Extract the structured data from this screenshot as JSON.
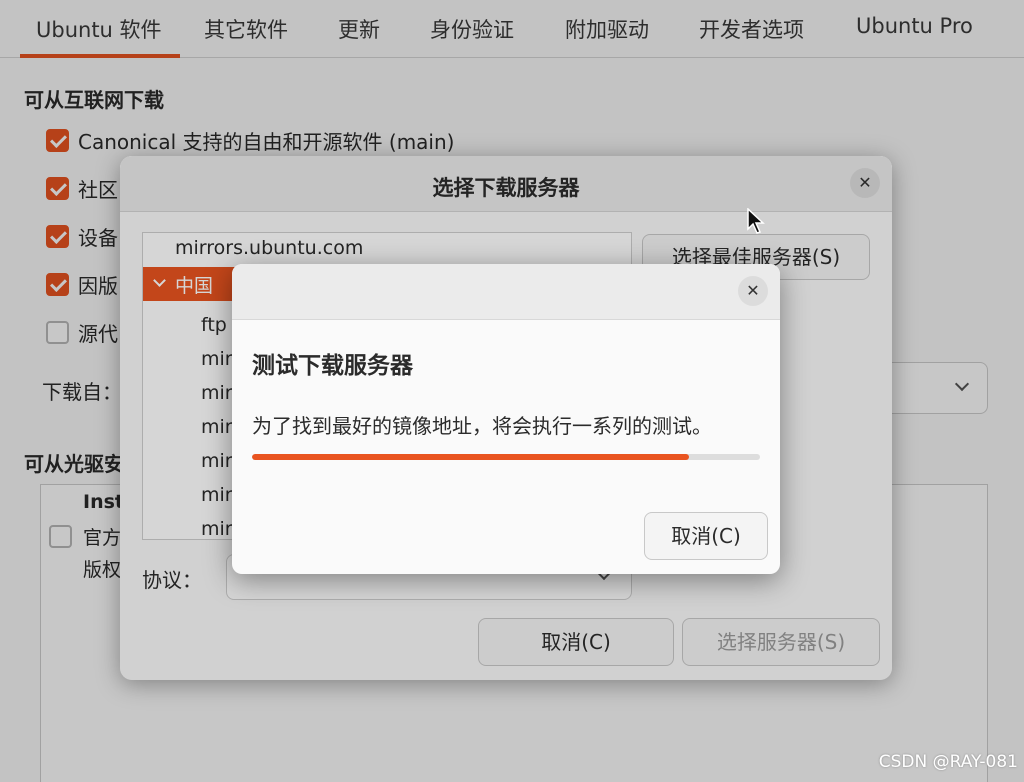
{
  "tabs": [
    "Ubuntu 软件",
    "其它软件",
    "更新",
    "身份验证",
    "附加驱动",
    "开发者选项",
    "Ubuntu Pro"
  ],
  "base": {
    "internet_section": "可从互联网下载",
    "checkboxes": [
      {
        "label": "Canonical 支持的自由和开源软件 (main)",
        "checked": true
      },
      {
        "label": "社区",
        "checked": true
      },
      {
        "label": "设备",
        "checked": true
      },
      {
        "label": "因版",
        "checked": true
      },
      {
        "label": "源代",
        "checked": false
      }
    ],
    "download_from_label": "下载自：",
    "cdrom_section": "可从光驱安",
    "cdrom_row1": "Inst",
    "cdrom_row2": "官方",
    "cdrom_row3": "版权"
  },
  "mirror_dialog": {
    "title": "选择下载服务器",
    "close_icon": "close-icon",
    "list": [
      {
        "label": "mirrors.ubuntu.com",
        "selected": false,
        "indent": 0
      },
      {
        "label": "中国",
        "selected": true,
        "indent": 0
      },
      {
        "label": "ftp",
        "selected": false,
        "indent": 1
      },
      {
        "label": "mir",
        "selected": false,
        "indent": 1
      },
      {
        "label": "mir",
        "selected": false,
        "indent": 1
      },
      {
        "label": "mir",
        "selected": false,
        "indent": 1
      },
      {
        "label": "mir",
        "selected": false,
        "indent": 1
      },
      {
        "label": "mir",
        "selected": false,
        "indent": 1
      },
      {
        "label": "mir",
        "selected": false,
        "indent": 1
      }
    ],
    "best_server_button": "选择最佳服务器(S)",
    "protocol_label": "协议：",
    "cancel_button": "取消(C)",
    "choose_server_button": "选择服务器(S)"
  },
  "test_dialog": {
    "heading": "测试下载服务器",
    "message": "为了找到最好的镜像地址，将会执行一系列的测试。",
    "progress": 0.86,
    "cancel_button": "取消(C)"
  },
  "colors": {
    "accent": "#e95420"
  },
  "watermark": "CSDN @RAY-081"
}
